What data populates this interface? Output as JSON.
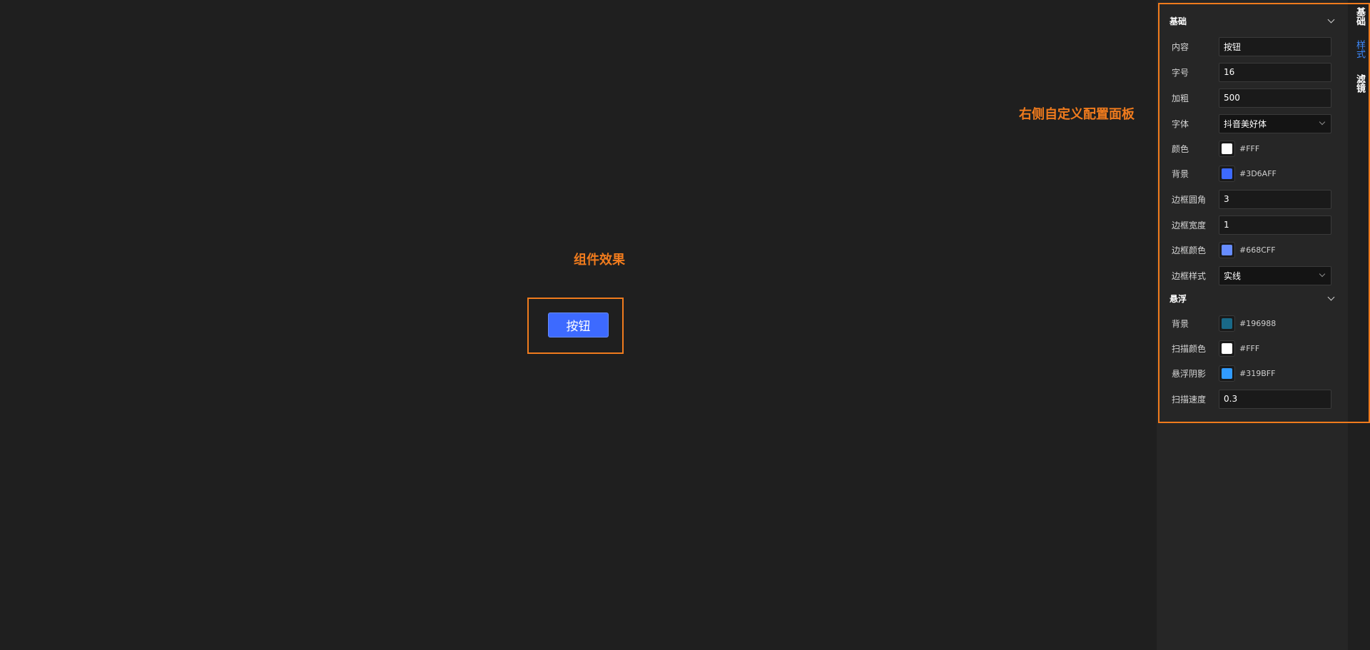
{
  "annotations": {
    "effect": "组件效果",
    "panel": "右侧自定义配置面板"
  },
  "preview": {
    "button_label": "按钮"
  },
  "tabs": {
    "basic": "基础",
    "style": "样式",
    "filter": "滤镜",
    "active": "样式"
  },
  "sections": {
    "basic": {
      "title": "基础",
      "content_label": "内容",
      "content_value": "按钮",
      "fontsize_label": "字号",
      "fontsize_value": "16",
      "weight_label": "加粗",
      "weight_value": "500",
      "font_label": "字体",
      "font_value": "抖音美好体",
      "color_label": "颜色",
      "color_value": "#FFF",
      "color_hex": "#ffffff",
      "bg_label": "背景",
      "bg_value": "#3D6AFF",
      "bg_hex": "#3d6aff",
      "radius_label": "边框圆角",
      "radius_value": "3",
      "bwidth_label": "边框宽度",
      "bwidth_value": "1",
      "bcolor_label": "边框颜色",
      "bcolor_value": "#668CFF",
      "bcolor_hex": "#668cff",
      "bstyle_label": "边框样式",
      "bstyle_value": "实线"
    },
    "hover": {
      "title": "悬浮",
      "bg_label": "背景",
      "bg_value": "#196988",
      "bg_hex": "#196988",
      "scancolor_label": "扫描颜色",
      "scancolor_value": "#FFF",
      "scancolor_hex": "#ffffff",
      "shadow_label": "悬浮阴影",
      "shadow_value": "#319BFF",
      "shadow_hex": "#319bff",
      "speed_label": "扫描速度",
      "speed_value": "0.3"
    }
  },
  "colors": {
    "accent": "#f07b1d",
    "primary": "#3d6aff",
    "tab_active": "#3d8bff"
  }
}
